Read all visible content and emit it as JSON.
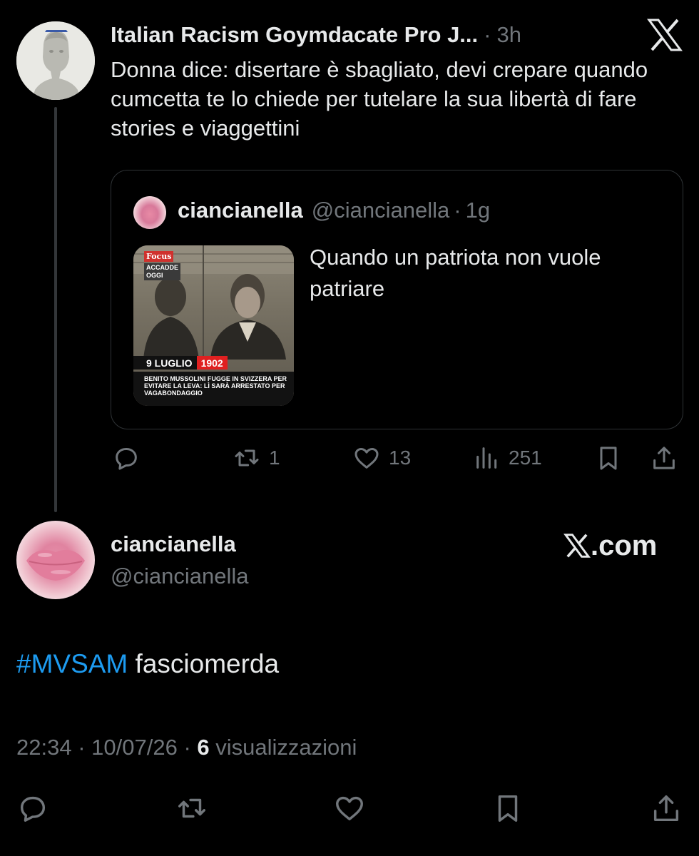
{
  "parent_tweet": {
    "author_name": "Italian Racism Goymdacate Pro J...",
    "separator": "·",
    "time": "3h",
    "text": "Donna dice: disertare è sbagliato, devi crepare quando cumcetta te lo chiede per tutelare la sua libertà di fare stories e viaggettini",
    "avatar_icon": "bust-statue-avatar",
    "logo_icon": "x-logo-icon"
  },
  "quoted_tweet": {
    "author_name": "ciancianella",
    "handle": "@ciancianella",
    "separator": "·",
    "time": "1g",
    "text": "Quando un patriota non vuole patriare",
    "image": {
      "badge": "Focus",
      "label_line1": "ACCADDE",
      "label_line2": "OGGI",
      "date_day": "9 LUGLIO",
      "date_year": "1902",
      "caption": "BENITO MUSSOLINI FUGGE IN SVIZZERA PER EVITARE LA LEVA: LÌ SARÀ ARRESTATO PER VAGABONDAGGIO"
    }
  },
  "parent_actions": {
    "reply_count": "",
    "retweet_count": "1",
    "like_count": "13",
    "views_count": "251"
  },
  "reply_tweet": {
    "author_name": "ciancianella",
    "handle": "@ciancianella",
    "hashtag": "#MVSAM",
    "text_rest": " fasciomerda",
    "source": ".com",
    "time": "22:34",
    "separator": "·",
    "date": "10/07/26",
    "views_count": "6",
    "views_label": "visualizzazioni"
  },
  "colors": {
    "background": "#000000",
    "text_primary": "#e7e9ea",
    "text_secondary": "#71767b",
    "link": "#1d9bf0",
    "border": "#2f3336"
  }
}
